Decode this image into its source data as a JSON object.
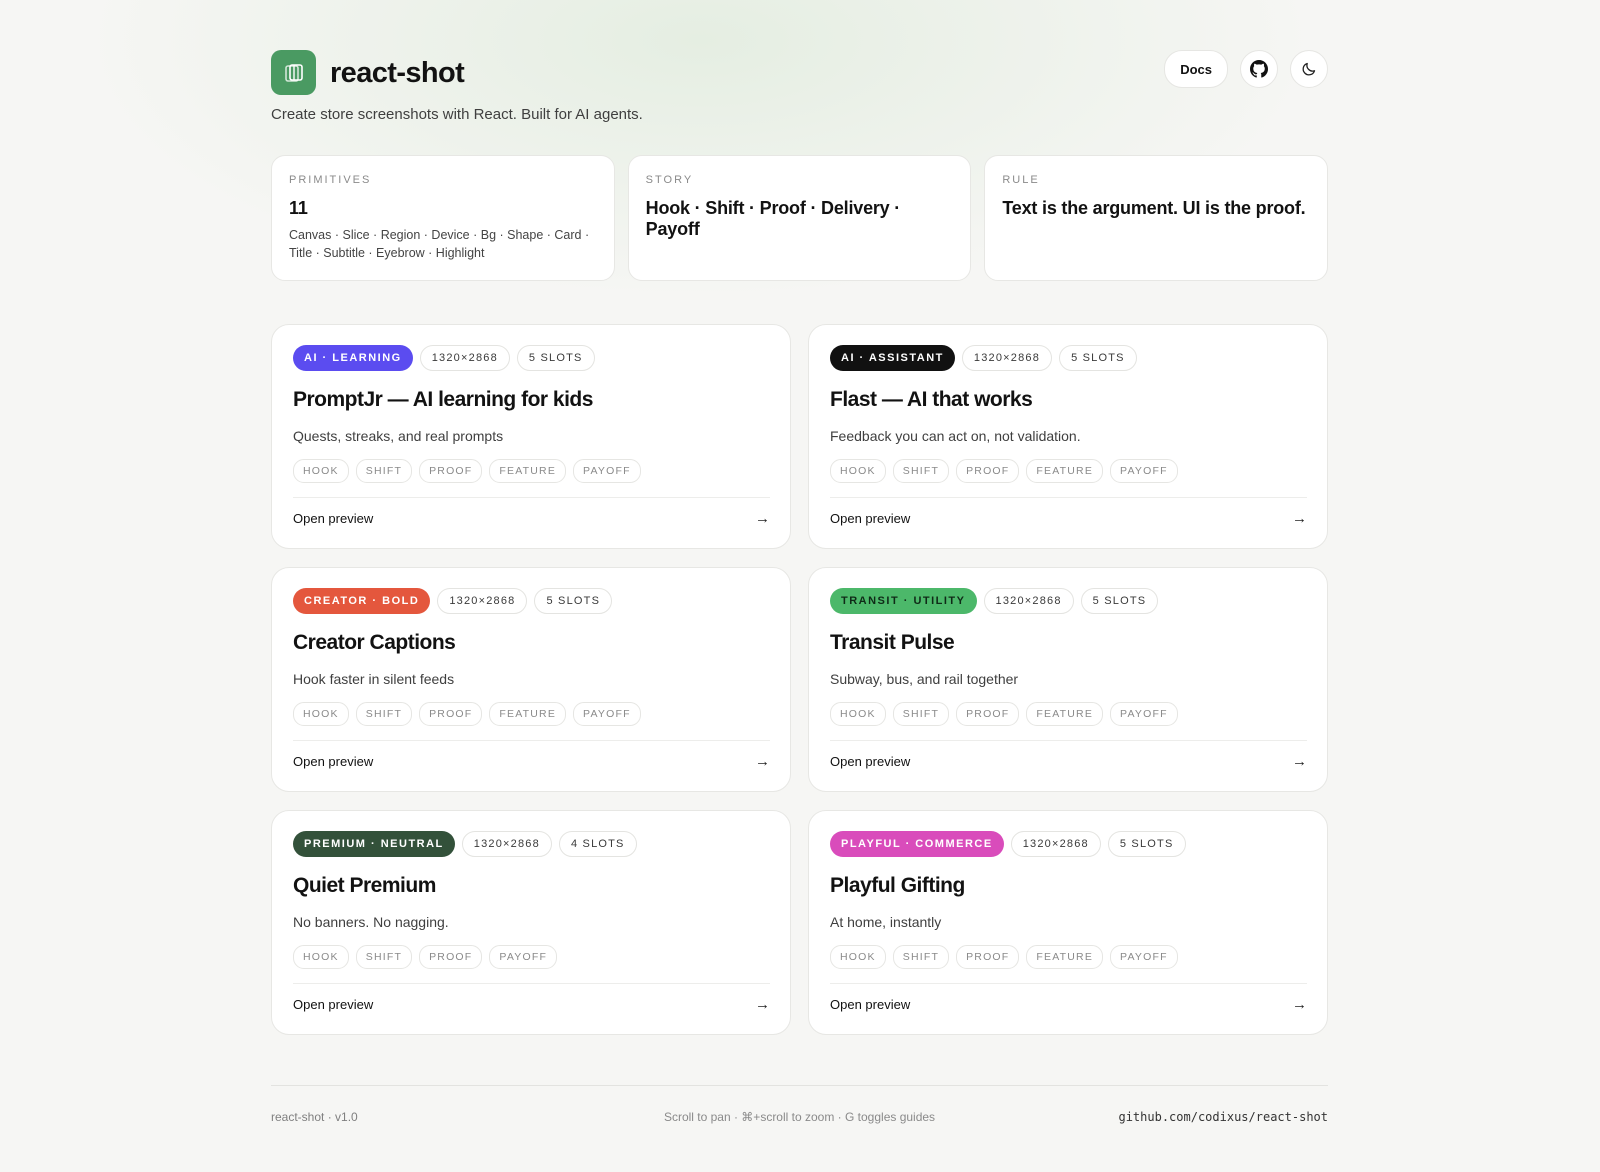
{
  "header": {
    "brand": "react-shot",
    "tagline": "Create store screenshots with React. Built for AI agents.",
    "docs_label": "Docs",
    "brand_color": "#4a9a62",
    "icons": [
      "app-logo-icon",
      "github-icon",
      "moon-icon"
    ]
  },
  "stats": [
    {
      "label": "PRIMITIVES",
      "value": "11",
      "sub": "Canvas · Slice · Region · Device · Bg · Shape · Card · Title · Subtitle · Eyebrow · Highlight"
    },
    {
      "label": "STORY",
      "value": "Hook · Shift · Proof · Delivery · Payoff",
      "sub": ""
    },
    {
      "label": "RULE",
      "value": "Text is the argument. UI is the proof.",
      "sub": ""
    }
  ],
  "cards": [
    {
      "category": "AI · LEARNING",
      "category_color": "#5b4cf0",
      "size": "1320×2868",
      "slots": "5 SLOTS",
      "title": "PromptJr — AI learning for kids",
      "subtitle": "Quests, streaks, and real prompts",
      "tags": [
        "HOOK",
        "SHIFT",
        "PROOF",
        "FEATURE",
        "PAYOFF"
      ],
      "link": "Open preview"
    },
    {
      "category": "AI · ASSISTANT",
      "category_color": "#111111",
      "size": "1320×2868",
      "slots": "5 SLOTS",
      "title": "Flast — AI that works",
      "subtitle": "Feedback you can act on, not validation.",
      "tags": [
        "HOOK",
        "SHIFT",
        "PROOF",
        "FEATURE",
        "PAYOFF"
      ],
      "link": "Open preview"
    },
    {
      "category": "CREATOR · BOLD",
      "category_color": "#e4573d",
      "size": "1320×2868",
      "slots": "5 SLOTS",
      "title": "Creator Captions",
      "subtitle": "Hook faster in silent feeds",
      "tags": [
        "HOOK",
        "SHIFT",
        "PROOF",
        "FEATURE",
        "PAYOFF"
      ],
      "link": "Open preview"
    },
    {
      "category": "TRANSIT · UTILITY",
      "category_color": "#4cb86a",
      "category_text_color": "#0f2a17",
      "size": "1320×2868",
      "slots": "5 SLOTS",
      "title": "Transit Pulse",
      "subtitle": "Subway, bus, and rail together",
      "tags": [
        "HOOK",
        "SHIFT",
        "PROOF",
        "FEATURE",
        "PAYOFF"
      ],
      "link": "Open preview"
    },
    {
      "category": "PREMIUM · NEUTRAL",
      "category_color": "#33513a",
      "size": "1320×2868",
      "slots": "4 SLOTS",
      "title": "Quiet Premium",
      "subtitle": "No banners. No nagging.",
      "tags": [
        "HOOK",
        "SHIFT",
        "PROOF",
        "PAYOFF"
      ],
      "link": "Open preview"
    },
    {
      "category": "PLAYFUL · COMMERCE",
      "category_color": "#d94cbb",
      "size": "1320×2868",
      "slots": "5 SLOTS",
      "title": "Playful Gifting",
      "subtitle": "At home, instantly",
      "tags": [
        "HOOK",
        "SHIFT",
        "PROOF",
        "FEATURE",
        "PAYOFF"
      ],
      "link": "Open preview"
    }
  ],
  "footer": {
    "version": "react-shot · v1.0",
    "hint": "Scroll to pan · ⌘+scroll to zoom · G toggles guides",
    "repo": "github.com/codixus/react-shot"
  }
}
